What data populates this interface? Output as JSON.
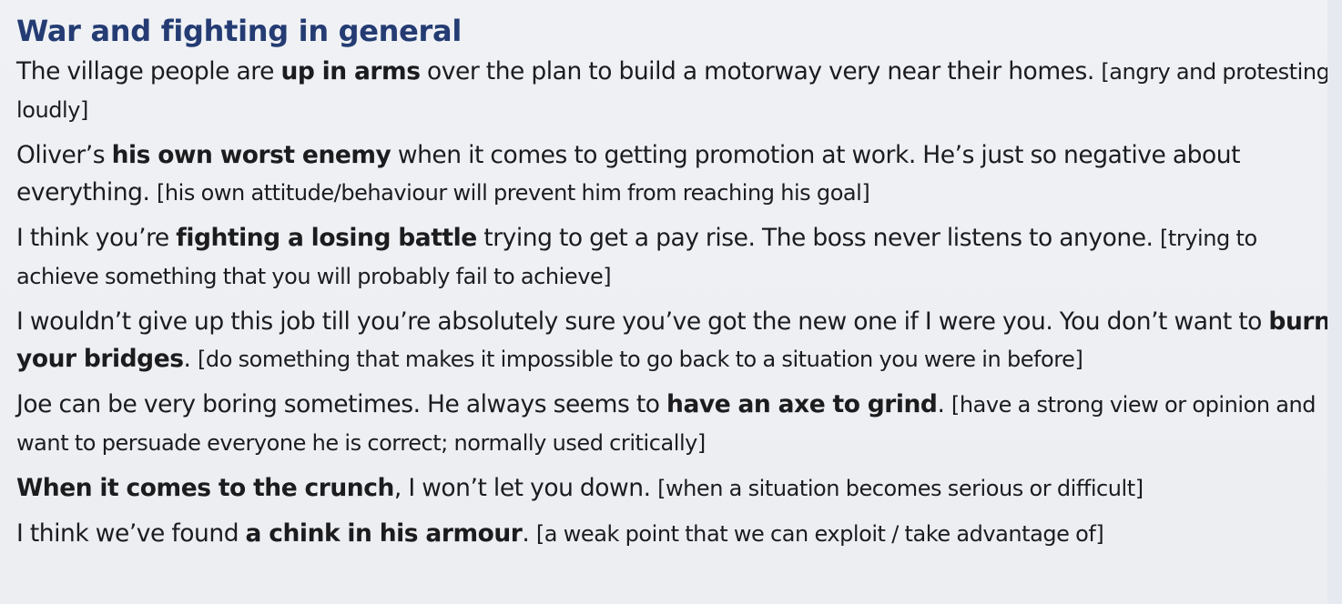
{
  "heading": "War and fighting in general",
  "entries": [
    {
      "before": "The village people are ",
      "phrase": "up in arms",
      "after": " over the plan to build a motorway very near their homes. ",
      "gloss": "[angry and protesting loudly]"
    },
    {
      "before": "Oliver’s ",
      "phrase": "his own worst enemy",
      "after": " when it comes to getting promotion at work. He’s just so negative about everything. ",
      "gloss": "[his own attitude/behaviour will prevent him from reaching his goal]"
    },
    {
      "before": "I think you’re ",
      "phrase": "fighting a losing battle",
      "after": " trying to get a pay rise. The boss never listens to anyone. ",
      "gloss": "[trying to achieve something that you will probably fail to achieve]"
    },
    {
      "before": "I wouldn’t give up this job till you’re absolutely sure you’ve got the new one if I were you. You don’t want to ",
      "phrase": "burn your bridges",
      "after": ". ",
      "gloss": "[do something that makes it impossible to go back to a situation you were in before]"
    },
    {
      "before": "Joe can be very boring sometimes. He always seems to ",
      "phrase": "have an axe to grind",
      "after": ". ",
      "gloss": "[have a strong view or opinion and want to persuade everyone he is correct; normally used critically]"
    },
    {
      "before": "",
      "phrase": "When it comes to the crunch",
      "after": ", I won’t let you down. ",
      "gloss": "[when a situation becomes serious or difficult]"
    },
    {
      "before": "I think we’ve found ",
      "phrase": "a chink in his armour",
      "after": ". ",
      "gloss": "[a weak point that we can exploit / take advantage of]"
    }
  ]
}
